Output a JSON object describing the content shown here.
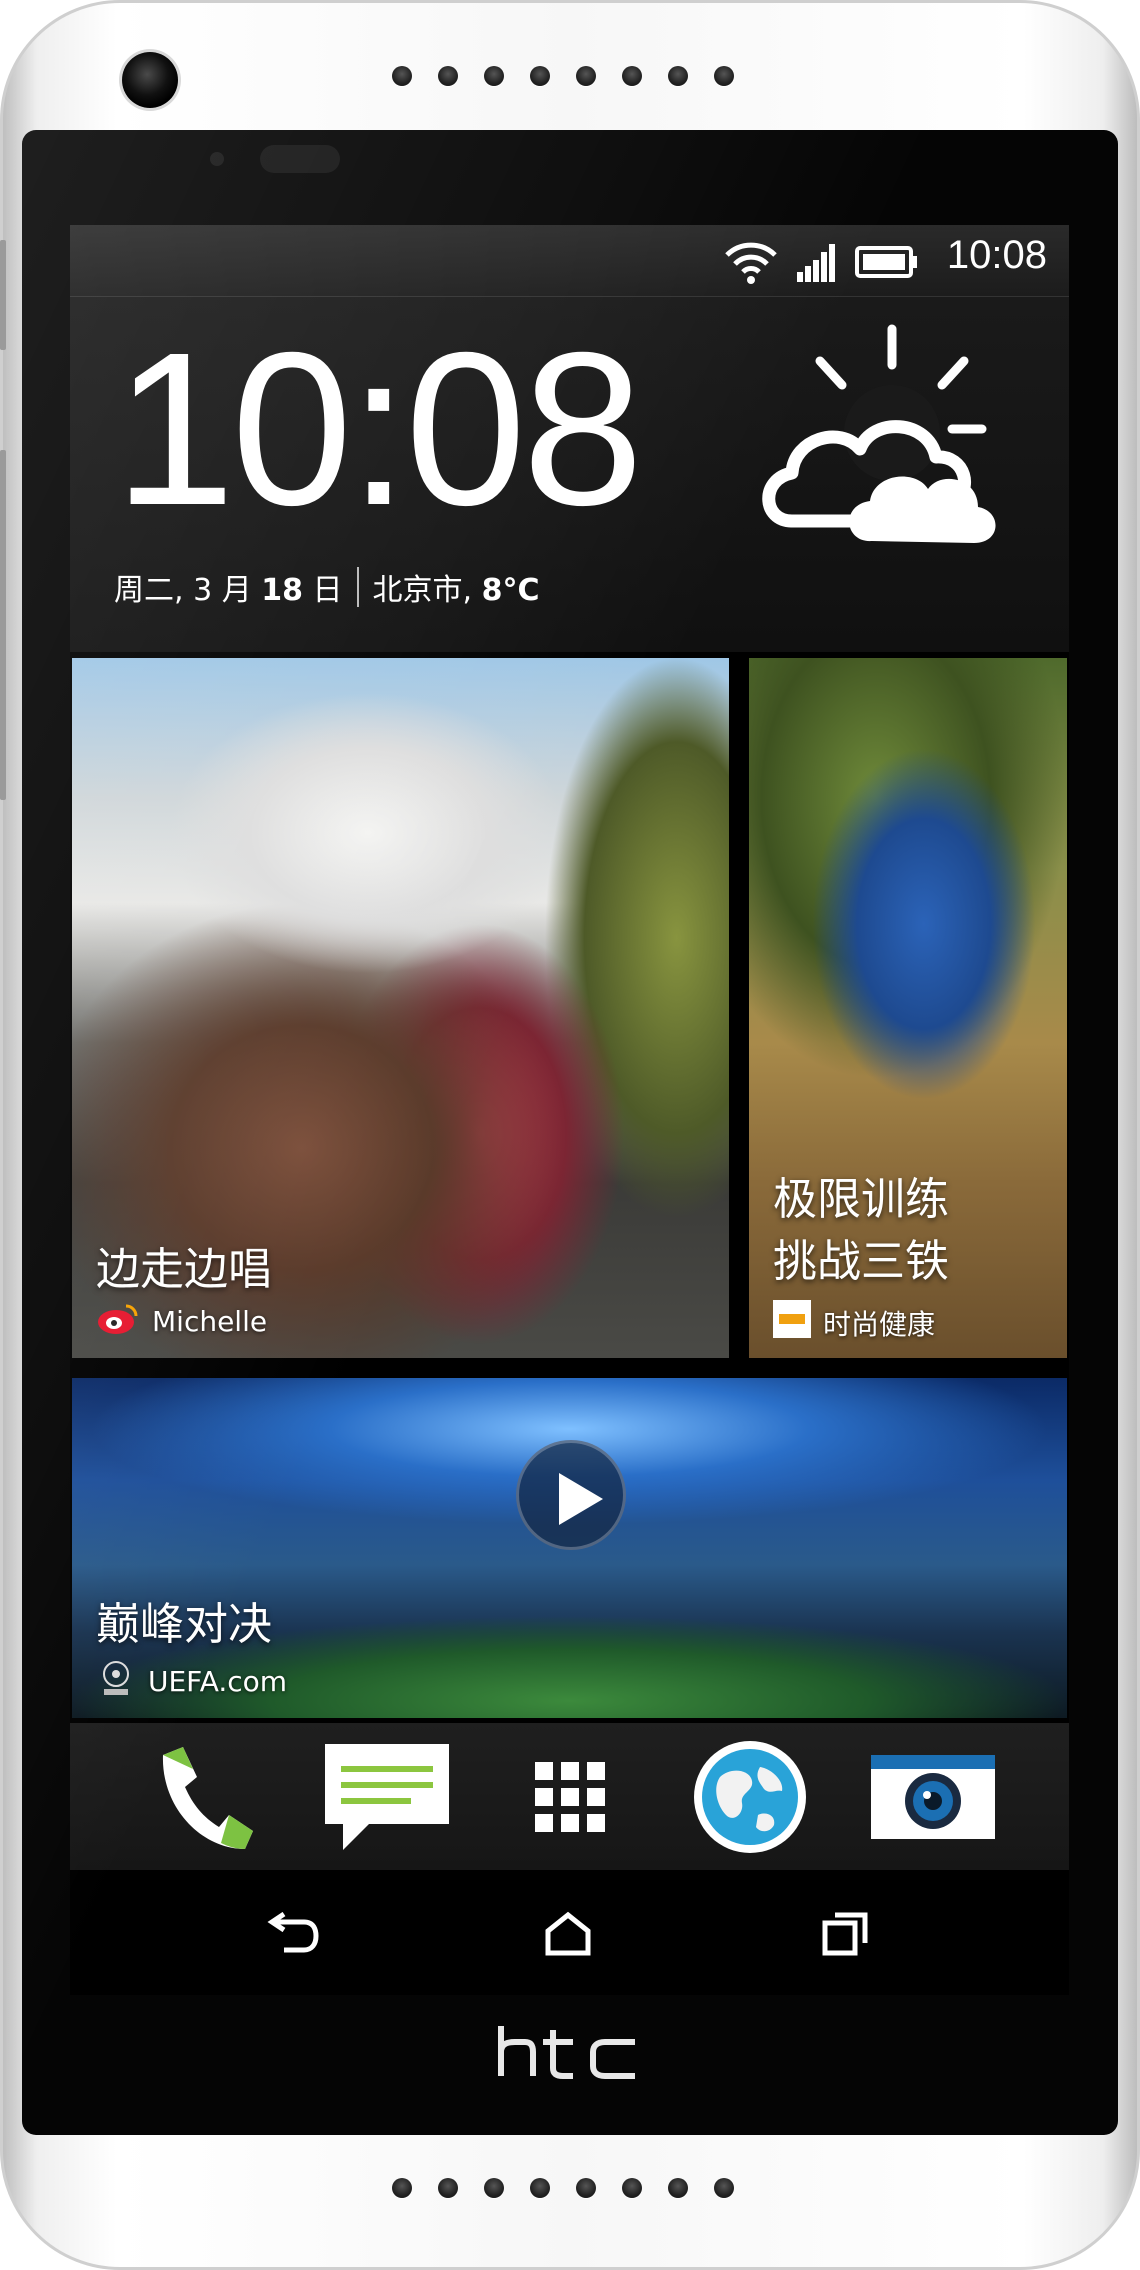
{
  "status_bar": {
    "time": "10:08",
    "icons": [
      "wifi-icon",
      "signal-icon",
      "battery-icon"
    ]
  },
  "clock_widget": {
    "time": "10:08",
    "date_prefix": "周二, 3 月 ",
    "date_day": "18",
    "date_suffix": " 日",
    "location": "北京市, ",
    "temperature": "8°C",
    "weather_icon": "partly-cloudy-icon"
  },
  "tiles": [
    {
      "caption": "边走边唱",
      "source": "Michelle",
      "source_icon": "weibo-icon"
    },
    {
      "caption_line1": "极限训练",
      "caption_line2": "挑战三铁",
      "source": "时尚健康",
      "source_icon": "publisher-logo-icon"
    },
    {
      "caption": "巅峰对决",
      "source": "UEFA.com",
      "source_icon": "champions-league-icon"
    }
  ],
  "dock": {
    "items": [
      {
        "name": "phone-icon",
        "color": "#7dc242"
      },
      {
        "name": "messages-icon",
        "color": "#8cc63f"
      },
      {
        "name": "app-drawer-icon",
        "color": "#ffffff"
      },
      {
        "name": "browser-globe-icon",
        "color": "#29a3d8"
      },
      {
        "name": "camera-icon",
        "color": "#1b6fb3"
      }
    ]
  },
  "nav": {
    "buttons": [
      "back-icon",
      "home-icon",
      "recents-icon"
    ]
  },
  "brand": "htc"
}
